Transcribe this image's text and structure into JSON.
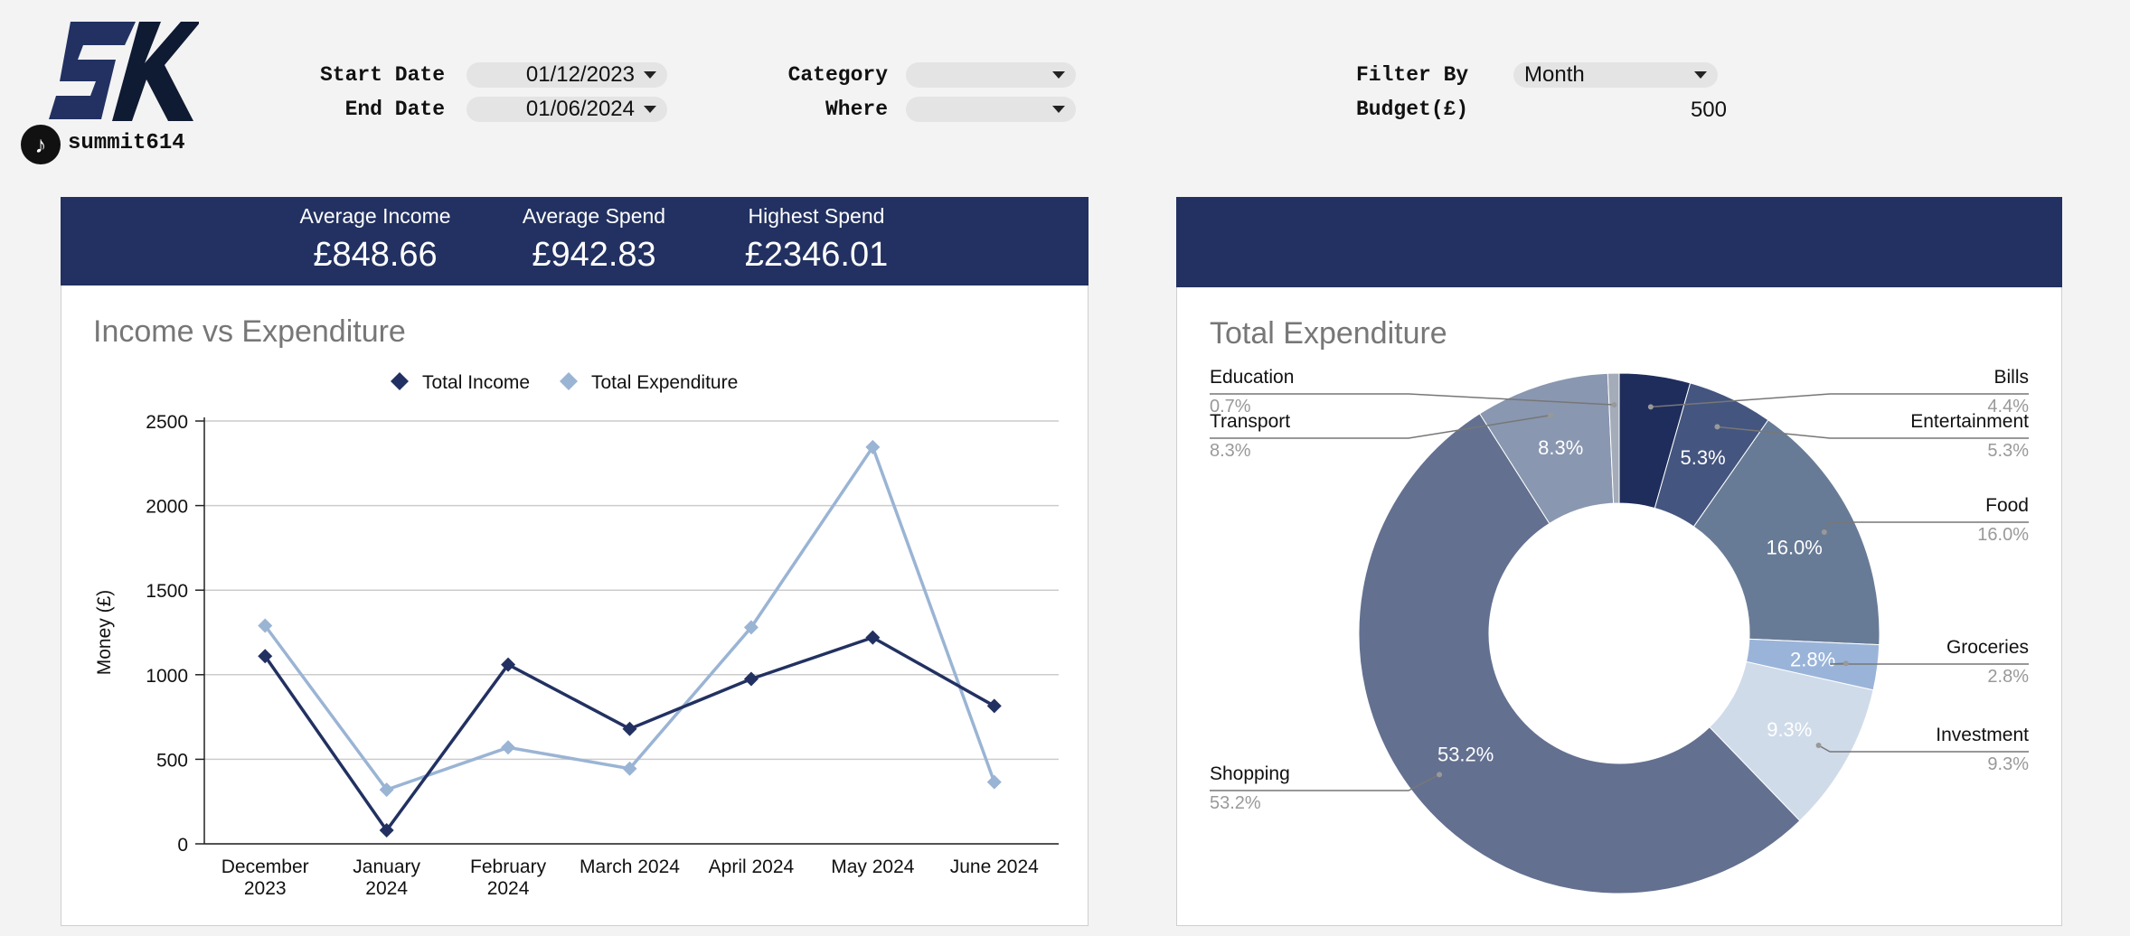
{
  "brand": {
    "handle": "summit614",
    "tiktok_glyph": "♪"
  },
  "filters": {
    "start_date_label": "Start Date",
    "start_date_value": "01/12/2023",
    "end_date_label": "End Date",
    "end_date_value": "01/06/2024",
    "category_label": "Category",
    "category_value": "",
    "where_label": "Where",
    "where_value": "",
    "filter_by_label": "Filter By",
    "filter_by_value": "Month",
    "budget_label": "Budget(£)",
    "budget_value": "500"
  },
  "kpis": [
    {
      "title": "Average Income",
      "value": "£848.66"
    },
    {
      "title": "Average Spend",
      "value": "£942.83"
    },
    {
      "title": "Highest Spend",
      "value": "£2346.01"
    }
  ],
  "colors": {
    "navy": "#223161",
    "light_blue": "#9ab4d4"
  },
  "chart_data": [
    {
      "type": "line",
      "title": "Income vs Expenditure",
      "ylabel": "Money (£)",
      "ylim": [
        0,
        2500
      ],
      "yticks": [
        "0",
        "500",
        "1000",
        "1500",
        "2000",
        "2500"
      ],
      "categories": [
        [
          "December",
          "2023"
        ],
        [
          "January",
          "2024"
        ],
        [
          "February",
          "2024"
        ],
        [
          "March 2024"
        ],
        [
          "April 2024"
        ],
        [
          "May 2024"
        ],
        [
          "June 2024"
        ]
      ],
      "legend_position": "top",
      "grid": true,
      "series": [
        {
          "name": "Total Income",
          "color": "#223161",
          "values": [
            1110,
            80,
            1060,
            680,
            975,
            1220,
            815
          ]
        },
        {
          "name": "Total Expenditure",
          "color": "#9ab4d4",
          "values": [
            1290,
            320,
            570,
            445,
            1280,
            2346.01,
            365
          ]
        }
      ]
    },
    {
      "type": "pie",
      "title": "Total Expenditure",
      "donut": true,
      "slices": [
        {
          "name": "Bills",
          "value": 4.4,
          "pct": "4.4%",
          "inner": "",
          "color": "#1f2d5c",
          "text": "#ffffff"
        },
        {
          "name": "Entertainment",
          "value": 5.3,
          "pct": "5.3%",
          "inner": "5.3%",
          "color": "#44557f",
          "text": "#ffffff"
        },
        {
          "name": "Food",
          "value": 16.0,
          "pct": "16.0%",
          "inner": "16.0%",
          "color": "#687b96",
          "text": "#ffffff"
        },
        {
          "name": "Groceries",
          "value": 2.8,
          "pct": "2.8%",
          "inner": "2.8%",
          "color": "#9ab4d9",
          "text": "#ffffff"
        },
        {
          "name": "Investment",
          "value": 9.3,
          "pct": "9.3%",
          "inner": "9.3%",
          "color": "#cfdbe9",
          "text": "#ffffff"
        },
        {
          "name": "Shopping",
          "value": 53.2,
          "pct": "53.2%",
          "inner": "53.2%",
          "color": "#637090",
          "text": "#ffffff"
        },
        {
          "name": "Transport",
          "value": 8.3,
          "pct": "8.3%",
          "inner": "8.3%",
          "color": "#8a97b0",
          "text": "#ffffff"
        },
        {
          "name": "Education",
          "value": 0.7,
          "pct": "0.7%",
          "inner": "",
          "color": "#a4abb9",
          "text": "#ffffff"
        }
      ]
    }
  ]
}
